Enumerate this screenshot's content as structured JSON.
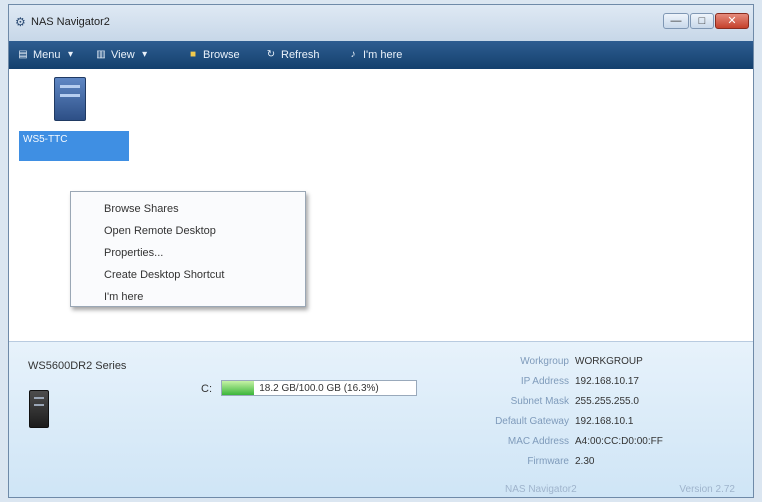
{
  "window": {
    "title": "NAS Navigator2",
    "icon": "app-logo-icon",
    "controls": [
      "—",
      "□",
      "✕"
    ]
  },
  "toolbar": {
    "menu_label": "Menu",
    "view_label": "View",
    "browse_label": "Browse",
    "refresh_label": "Refresh",
    "im_here_label": "I'm here",
    "icons": [
      "menu-icon",
      "view-icon",
      "browse-icon",
      "refresh-icon",
      "im-here-icon"
    ]
  },
  "device": {
    "label": "WS5-TTC",
    "icon": "nas-icon"
  },
  "context_menu": {
    "items": [
      "Browse Shares",
      "Open Remote Desktop",
      "Properties...",
      "Create Desktop Shortcut",
      "I'm here"
    ]
  },
  "status_panel": {
    "series_name": "WS5600DR2 Series",
    "drive_letter": "C:",
    "disk_usage_text": "18.2 GB/100.0 GB (16.3%)",
    "disk_usage_fraction": 0.163,
    "info": [
      {
        "label": "Workgroup",
        "value": "WORKGROUP"
      },
      {
        "label": "IP Address",
        "value": "192.168.10.17"
      },
      {
        "label": "Subnet Mask",
        "value": "255.255.255.0"
      },
      {
        "label": "Default Gateway",
        "value": "192.168.10.1"
      },
      {
        "label": "MAC Address",
        "value": "A4:00:CC:D0:00:FF"
      },
      {
        "label": "Firmware",
        "value": "2.30"
      }
    ],
    "footer_link": "NAS Navigator2",
    "version": "Version 2.72"
  },
  "colors": {
    "toolbar_bg": "#1f4d80",
    "selection": "#3f8fe3",
    "disk_fill": "#3bb63a"
  }
}
